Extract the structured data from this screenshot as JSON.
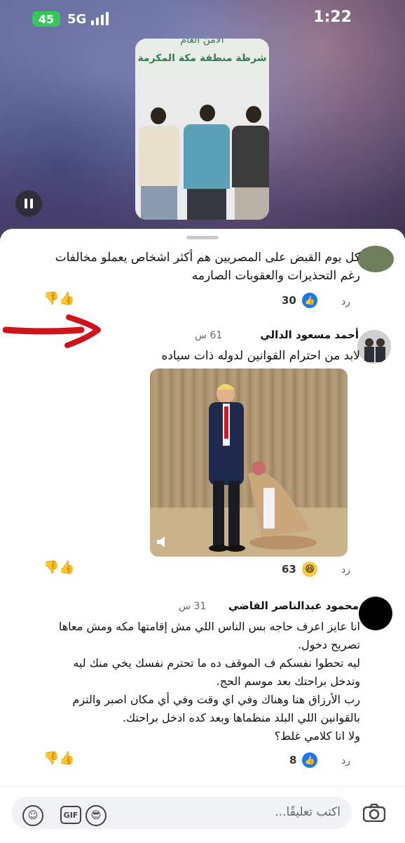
{
  "status_bar": {
    "battery": "45",
    "network": "5G",
    "time": "1:22"
  },
  "story": {
    "top_text": "الأمن العام",
    "subtitle": "شرطة منطقة مكة المكرمة"
  },
  "comments": [
    {
      "text": "كل يوم القبض على المصريين هم أكثر اشخاص يعملو مخالفات رغم التحذيرات والعقوبات الصارمه",
      "reply": "رد",
      "reaction_count": "30"
    },
    {
      "author": "أحمد مسعود الدالي",
      "ago": "61 س",
      "text": "لابد من احترام القوانين لدوله ذات سياده",
      "reply": "رد",
      "reaction_count": "63"
    },
    {
      "author": "محمود عبدالناصر القاضي",
      "ago": "31 س",
      "text": "انا عايز اعرف حاجه بس الناس اللي مش إقامتها مكه ومش معاها تصريح دخول.\nليه تحطوا نفسكم ف الموقف ده ما تحترم نفسك يخي منك ليه وتدخل براحتك بعد موسم الحج.\nرب الأرزاق هنا وهناك وفي اي وقت وفي أي مكان اصبر والتزم بالقوانين اللي البلد منظماها وبعد كده ادخل براحتك.\nولا انا كلامي غلط؟",
      "reply": "رد",
      "reaction_count": "8"
    }
  ],
  "composer": {
    "placeholder": "اكتب تعليقًا..."
  },
  "icons": {
    "emoji": "emoji-icon",
    "gif": "GIF",
    "sticker": "sticker-icon",
    "camera": "camera-icon"
  },
  "colors": {
    "like_blue": "#1877f2",
    "haha_yellow": "#f7c944",
    "arrow_red": "#d0121a"
  }
}
